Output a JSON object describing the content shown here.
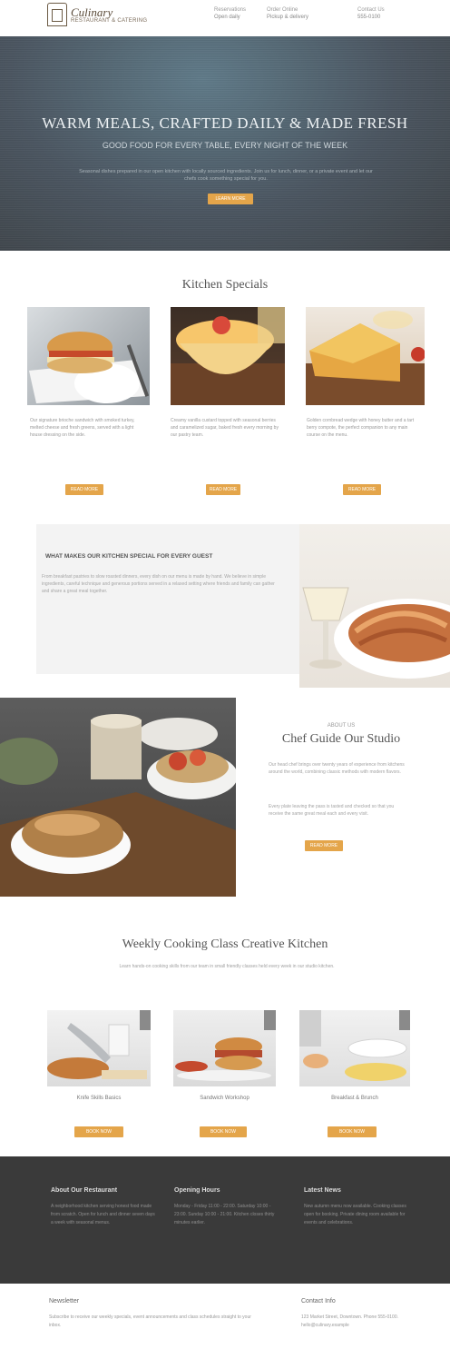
{
  "header": {
    "logo_title": "Culinary",
    "logo_sub": "RESTAURANT & CATERING",
    "nav": [
      {
        "label": "Reservations",
        "sub": "Open daily"
      },
      {
        "label": "Order Online",
        "sub": "Pickup & delivery"
      },
      {
        "label": "Contact Us",
        "sub": "555-0100"
      }
    ]
  },
  "hero": {
    "title": "WARM MEALS, CRAFTED DAILY & MADE FRESH",
    "subtitle": "GOOD FOOD FOR EVERY TABLE, EVERY NIGHT OF THE WEEK",
    "text": "Seasonal dishes prepared in our open kitchen with locally sourced ingredients. Join us for lunch, dinner, or a private event and let our chefs cook something special for you.",
    "button": "LEARN MORE"
  },
  "specials": {
    "title": "Kitchen Specials",
    "cards": [
      {
        "text": "Our signature brioche sandwich with smoked turkey, melted cheese and fresh greens, served with a light house dressing on the side.",
        "button": "READ MORE"
      },
      {
        "text": "Creamy vanilla custard topped with seasonal berries and caramelized sugar, baked fresh every morning by our pastry team.",
        "button": "READ MORE"
      },
      {
        "text": "Golden cornbread wedge with honey butter and a tart berry compote, the perfect companion to any main course on the menu.",
        "button": "READ MORE"
      }
    ]
  },
  "story": {
    "title": "WHAT MAKES OUR KITCHEN SPECIAL FOR EVERY GUEST",
    "text": "From breakfast pastries to slow roasted dinners, every dish on our menu is made by hand. We believe in simple ingredients, careful technique and generous portions served in a relaxed setting where friends and family can gather and share a great meal together."
  },
  "chef": {
    "kicker": "ABOUT US",
    "title": "Chef Guide Our Studio",
    "text1": "Our head chef brings over twenty years of experience from kitchens around the world, combining classic methods with modern flavors.",
    "text2": "Every plate leaving the pass is tasted and checked so that you receive the same great meal each and every visit.",
    "button": "READ MORE"
  },
  "workshops": {
    "title": "Weekly Cooking Class Creative Kitchen",
    "text": "Learn hands-on cooking skills from our team in small friendly classes held every week in our studio kitchen.",
    "cards": [
      {
        "caption": "Knife Skills Basics",
        "button": "BOOK NOW"
      },
      {
        "caption": "Sandwich Workshop",
        "button": "BOOK NOW"
      },
      {
        "caption": "Breakfast & Brunch",
        "button": "BOOK NOW"
      }
    ]
  },
  "footer": {
    "cols": [
      {
        "title": "About Our Restaurant",
        "text": "A neighborhood kitchen serving honest food made from scratch. Open for lunch and dinner seven days a week with seasonal menus."
      },
      {
        "title": "Opening Hours",
        "text": "Monday - Friday 11:00 - 22:00. Saturday 10:00 - 23:00. Sunday 10:00 - 21:00. Kitchen closes thirty minutes earlier."
      },
      {
        "title": "Latest News",
        "text": "New autumn menu now available. Cooking classes open for booking. Private dining room available for events and celebrations."
      }
    ]
  },
  "bottom": {
    "left_title": "Newsletter",
    "left_text": "Subscribe to receive our weekly specials, event announcements and class schedules straight to your inbox.",
    "right_title": "Contact Info",
    "right_text": "123 Market Street, Downtown. Phone 555-0100. hello@culinary.example"
  }
}
